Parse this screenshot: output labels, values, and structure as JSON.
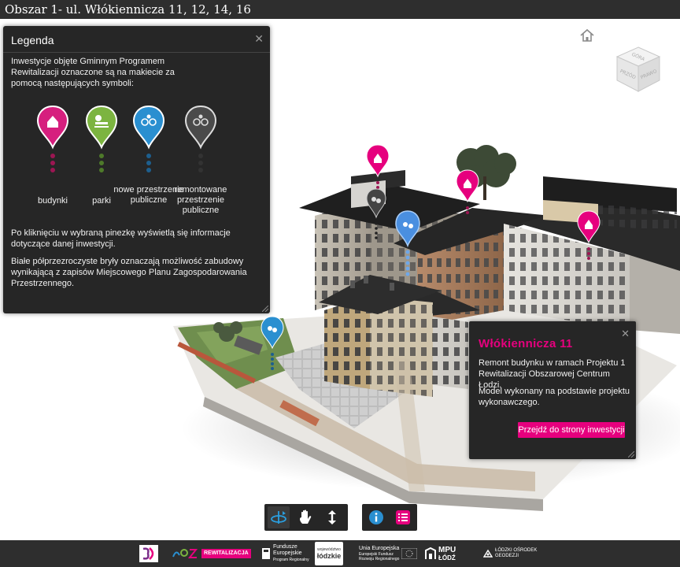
{
  "window": {
    "title": "Obszar 1- ul. Włókiennicza 11, 12, 14, 16"
  },
  "viewer": {
    "navcube": {
      "top_label": "GÓRA",
      "front_label": "PRZÓD",
      "right_label": "PRAWO"
    },
    "pins": [
      {
        "type": "budynki",
        "color": "#e6007e"
      },
      {
        "type": "remontowane przestrzenie publiczne",
        "color": "#444444"
      },
      {
        "type": "nowe przestrzenie publiczne",
        "color": "#4a8fe0"
      }
    ]
  },
  "legend": {
    "title": "Legenda",
    "intro": "Inwestycje objęte Gminnym Programem Rewitalizacji oznaczone są na makiecie za pomocą następujących symboli:",
    "symbols": [
      {
        "label": "budynki",
        "color": "#d61f7e",
        "dot_color": "#9c1652"
      },
      {
        "label": "parki",
        "color": "#7cb440",
        "dot_color": "#4e7a2a"
      },
      {
        "label": "nowe przestrzenie publiczne",
        "color": "#2a8fd0",
        "dot_color": "#1d5f8e"
      },
      {
        "label": "remontowane przestrzenie publiczne",
        "color": "#4a4a4a",
        "dot_color": "#333333"
      }
    ],
    "paragraph1": "Po kliknięciu w wybraną pinezkę wyświetlą się informacje dotyczące danej inwestycji.",
    "paragraph2": "Białe półprzezroczyste bryły oznaczają możliwość zabudowy wynikającą z zapisów Miejscowego Planu Zagospodarowania Przestrzennego."
  },
  "info": {
    "title": "Włókiennicza 11",
    "paragraph1": "Remont budynku w ramach Projektu 1 Rewitalizacji Obszarowej Centrum Łodzi.",
    "paragraph2": "Model wykonany na podstawie projektu wykonawczego.",
    "button_label": "Przejdź do strony inwestycji"
  },
  "toolbar": {
    "accent": "#e6007e",
    "info_color": "#2a8fd0",
    "active_tool": "orbit"
  },
  "footer": {
    "logos": {
      "rewitalizacja": "REWITALIZACJA",
      "fundusze_line1": "Fundusze",
      "fundusze_line2": "Europejskie",
      "fundusze_line3": "Program Regionalny",
      "lodzkie_small": "województwo",
      "lodzkie": "łódzkie",
      "ue_line1": "Unia Europejska",
      "ue_line2": "Europejski Fundusz",
      "ue_line3": "Rozwoju Regionalnego",
      "mpu_line1": "MPU",
      "mpu_line2": "ŁÓDŹ",
      "lodg_line1": "ŁÓDZKI OŚRODEK",
      "lodg_line2": "GEODEZJI"
    }
  }
}
